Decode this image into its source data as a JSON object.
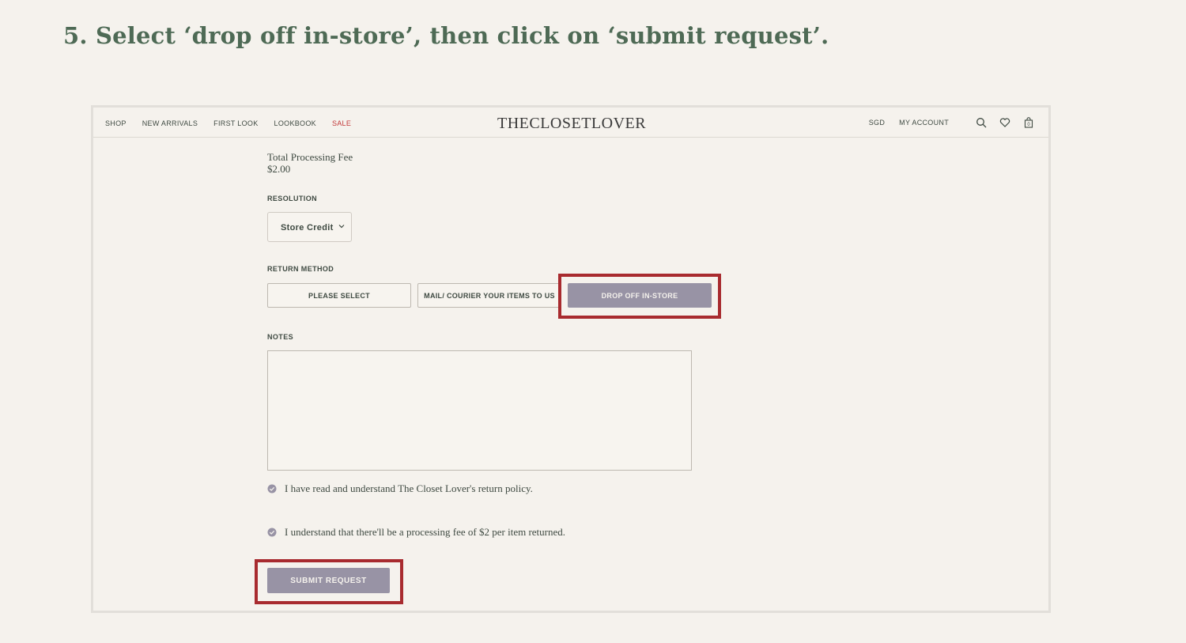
{
  "instruction": "5. Select ‘drop off in-store’, then click on ‘submit request’.",
  "nav": {
    "items": [
      "SHOP",
      "NEW ARRIVALS",
      "FIRST LOOK",
      "LOOKBOOK",
      "SALE"
    ],
    "logo": "THECLOSETLOVER",
    "currency": "SGD",
    "account": "MY ACCOUNT",
    "cart_count": "0"
  },
  "form": {
    "fee_label": "Total Processing Fee",
    "fee_value": "$2.00",
    "resolution_label": "RESOLUTION",
    "resolution_value": "Store Credit",
    "return_method_label": "RETURN METHOD",
    "methods": [
      "PLEASE SELECT",
      "MAIL/ COURIER YOUR ITEMS TO US",
      "DROP OFF IN-STORE"
    ],
    "selected_method": "DROP OFF IN-STORE",
    "notes_label": "NOTES",
    "notes_value": "",
    "check_policy": "I have read and understand The Closet Lover's return policy.",
    "check_fee": "I understand that there'll be a processing fee of $2 per item returned.",
    "submit_label": "SUBMIT REQUEST"
  },
  "colors": {
    "accent": "#9893a5",
    "highlight": "#a82b2f",
    "text": "#3f4a42",
    "sale": "#c23a3a",
    "background": "#f5f2ed"
  }
}
